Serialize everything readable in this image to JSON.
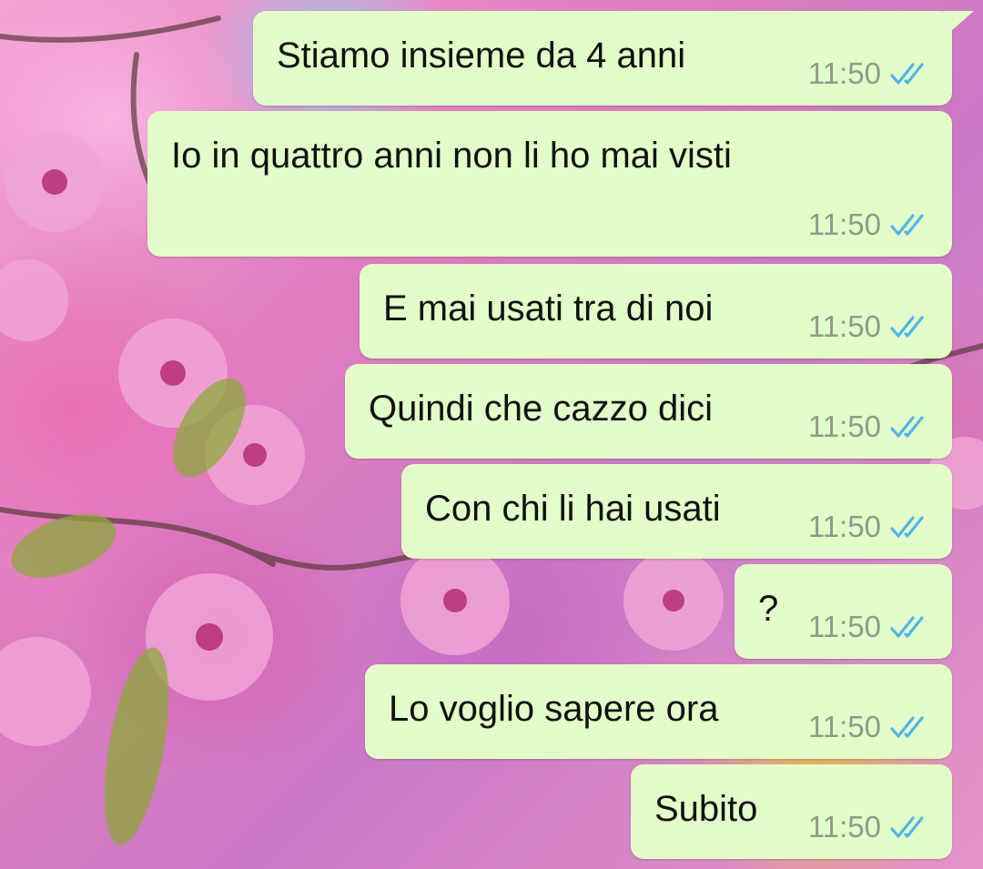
{
  "chat": {
    "background": "cherry-blossom-wallpaper",
    "bubble_color": "#e3fdc8",
    "tick_color": "#4fb6ec",
    "messages": [
      {
        "text": "Stiamo insieme da 4 anni",
        "time": "11:50",
        "status": "read-double-check-icon"
      },
      {
        "text": "Io in quattro anni non li ho mai visti",
        "time": "11:50",
        "status": "read-double-check-icon"
      },
      {
        "text": "E mai usati tra di noi",
        "time": "11:50",
        "status": "read-double-check-icon"
      },
      {
        "text": "Quindi che cazzo dici",
        "time": "11:50",
        "status": "read-double-check-icon"
      },
      {
        "text": "Con chi li hai usati",
        "time": "11:50",
        "status": "read-double-check-icon"
      },
      {
        "text": "?",
        "time": "11:50",
        "status": "read-double-check-icon"
      },
      {
        "text": "Lo voglio sapere ora",
        "time": "11:50",
        "status": "read-double-check-icon"
      },
      {
        "text": "Subito",
        "time": "11:50",
        "status": "read-double-check-icon"
      }
    ]
  }
}
